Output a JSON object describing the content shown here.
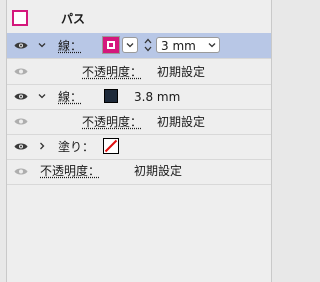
{
  "colors": {
    "accent": "#d4187c",
    "selection": "#b8c7e6",
    "stroke_swatch": "#1e2a3a",
    "fill_none_red": "#e01010"
  },
  "header": {
    "title": "パス"
  },
  "rows": [
    {
      "label": "線：",
      "stroke_size": "3 mm",
      "stepper_icon": "stepper-icon",
      "dropdown_icon": "chevron-down-icon"
    },
    {
      "label": "不透明度：",
      "value": "初期設定"
    },
    {
      "label": "線：",
      "stroke_size": "3.8 mm"
    },
    {
      "label": "不透明度：",
      "value": "初期設定"
    },
    {
      "label": "塗り："
    },
    {
      "label": "不透明度：",
      "value": "初期設定"
    }
  ]
}
